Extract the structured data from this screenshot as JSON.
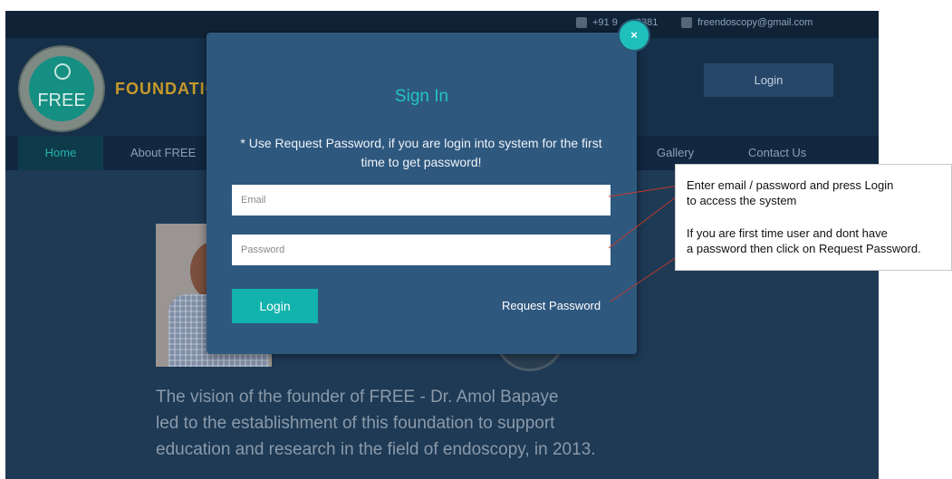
{
  "topbar": {
    "phone": "+91 9",
    "phone_end": "3381",
    "email": "freendoscopy@gmail.com"
  },
  "header": {
    "logo_text": "FREE",
    "brand": "FOUNDATIO",
    "login_label": "Login"
  },
  "nav": {
    "items": [
      "Home",
      "About FREE",
      "Gallery",
      "Contact Us"
    ]
  },
  "vision": {
    "lines": [
      "The vision of the founder of FREE - Dr. Amol Bapaye",
      "led to the establishment of this foundation to support",
      "education and research in the field of endoscopy, in 2013."
    ]
  },
  "modal": {
    "title": "Sign In",
    "note": "* Use Request Password, if you are login into system for the first time to get password!",
    "email_placeholder": "Email",
    "password_placeholder": "Password",
    "login_label": "Login",
    "request_label": "Request Password",
    "close_label": "×"
  },
  "callout": {
    "line1": "Enter email / password and press Login",
    "line2": "to access the system",
    "line3": "If you are first time user and dont have",
    "line4": "a password then click on Request Password."
  },
  "colors": {
    "accent": "#1ec0bb",
    "modal_bg": "#2f587f",
    "site_bg": "#1e3a55",
    "leader_line": "#c0392b"
  }
}
